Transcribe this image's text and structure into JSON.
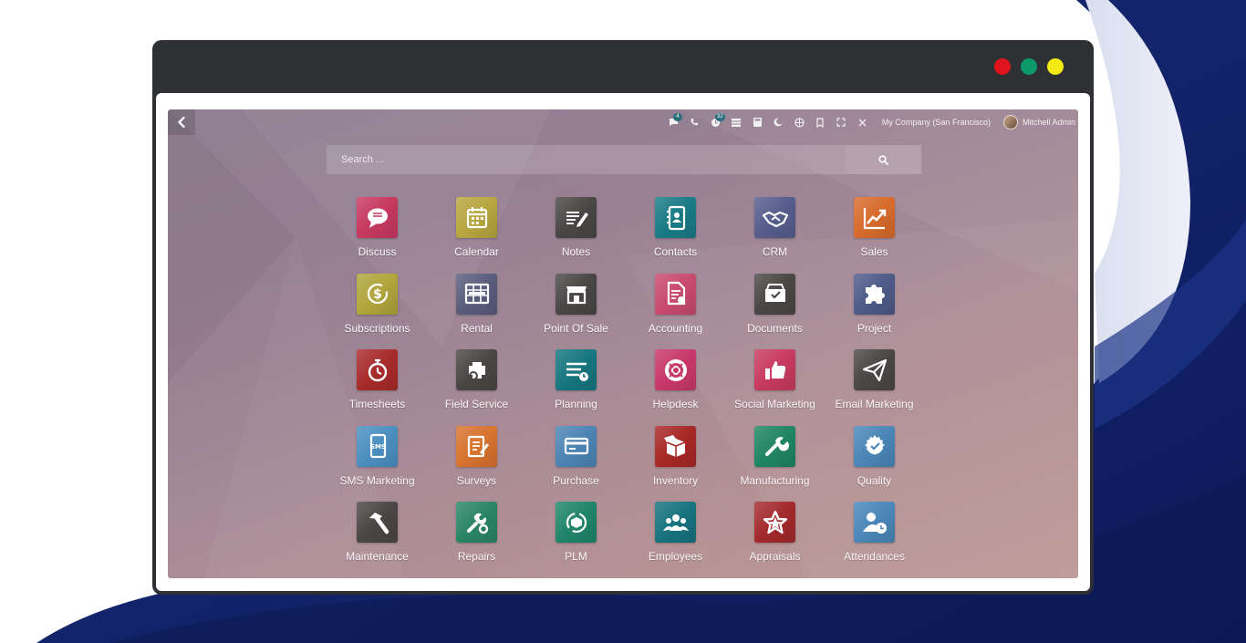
{
  "window": {
    "dots": [
      "#e0141c",
      "#0d9a6a",
      "#f2ea12"
    ]
  },
  "topbar": {
    "back_icon": "chevron-left-icon",
    "messages_badge": "4",
    "activity_badge": "32",
    "company": "My Company (San Francisco)",
    "user": "Mitchell Admin"
  },
  "search": {
    "placeholder": "Search ..."
  },
  "apps": [
    {
      "label": "Discuss",
      "icon": "chat-bubble-icon",
      "color": "#c6395f"
    },
    {
      "label": "Calendar",
      "icon": "calendar-icon",
      "color": "#b8a640"
    },
    {
      "label": "Notes",
      "icon": "pen-paper-icon",
      "color": "#4a4646"
    },
    {
      "label": "Contacts",
      "icon": "address-book-icon",
      "color": "#197b86"
    },
    {
      "label": "CRM",
      "icon": "handshake-icon",
      "color": "#565d8c"
    },
    {
      "label": "Sales",
      "icon": "trending-chart-icon",
      "color": "#d76b2c"
    },
    {
      "label": "Subscriptions",
      "icon": "recurring-dollar-icon",
      "color": "#b1a53c"
    },
    {
      "label": "Rental",
      "icon": "rental-board-icon",
      "color": "#595d7c"
    },
    {
      "label": "Point Of Sale",
      "icon": "store-icon",
      "color": "#4a4646"
    },
    {
      "label": "Accounting",
      "icon": "invoice-gear-icon",
      "color": "#c84a6f"
    },
    {
      "label": "Documents",
      "icon": "document-folder-icon",
      "color": "#4a4646"
    },
    {
      "label": "Project",
      "icon": "puzzle-icon",
      "color": "#4e5a88"
    },
    {
      "label": "Timesheets",
      "icon": "stopwatch-icon",
      "color": "#a82b2b"
    },
    {
      "label": "Field Service",
      "icon": "field-service-icon",
      "color": "#4a4646"
    },
    {
      "label": "Planning",
      "icon": "planning-list-icon",
      "color": "#16767f"
    },
    {
      "label": "Helpdesk",
      "icon": "lifebuoy-icon",
      "color": "#c8386a"
    },
    {
      "label": "Social Marketing",
      "icon": "thumbs-up-icon",
      "color": "#c83a5f"
    },
    {
      "label": "Email Marketing",
      "icon": "paper-plane-icon",
      "color": "#4a4646"
    },
    {
      "label": "SMS Marketing",
      "icon": "sms-phone-icon",
      "color": "#4b8fc0"
    },
    {
      "label": "Surveys",
      "icon": "survey-clipboard-icon",
      "color": "#d7732e"
    },
    {
      "label": "Purchase",
      "icon": "credit-card-icon",
      "color": "#4c84b4"
    },
    {
      "label": "Inventory",
      "icon": "open-box-icon",
      "color": "#a72826"
    },
    {
      "label": "Manufacturing",
      "icon": "wrench-icon",
      "color": "#1f8562"
    },
    {
      "label": "Quality",
      "icon": "quality-seal-icon",
      "color": "#4a86b7"
    },
    {
      "label": "Maintenance",
      "icon": "hammer-icon",
      "color": "#4a4646"
    },
    {
      "label": "Repairs",
      "icon": "repair-tools-icon",
      "color": "#2b8466"
    },
    {
      "label": "PLM",
      "icon": "plm-cycle-icon",
      "color": "#20856a"
    },
    {
      "label": "Employees",
      "icon": "people-group-icon",
      "color": "#17737e"
    },
    {
      "label": "Appraisals",
      "icon": "star-badge-icon",
      "color": "#a32a2c"
    },
    {
      "label": "Attendances",
      "icon": "user-clock-icon",
      "color": "#4a87b8"
    }
  ]
}
